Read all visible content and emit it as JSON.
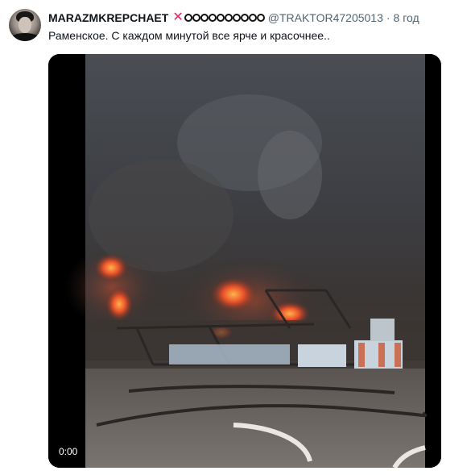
{
  "tweet": {
    "display_name": "MARAZMKREPCHAET",
    "badge_mark": "✕",
    "decorative_circles": 10,
    "handle": "@TRAKTOR47205013",
    "separator": "·",
    "time": "8 год",
    "text": "Раменское. С каждом минутой все ярче и красочнее..",
    "avatar_icon": "person-avatar",
    "media": {
      "type": "video",
      "duration": "0:00",
      "scene": "fire-smoke-scene"
    }
  },
  "colors": {
    "badge_mark": "#e0245e",
    "secondary_text": "#536471",
    "primary_text": "#0f1419"
  }
}
